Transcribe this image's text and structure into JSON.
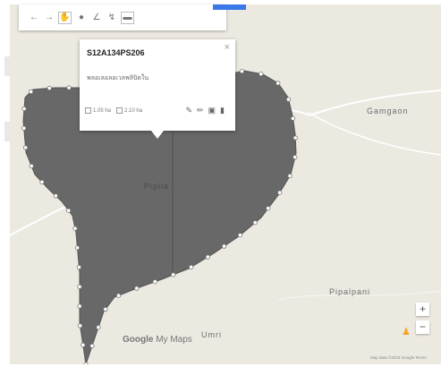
{
  "map": {
    "places": [
      {
        "label": "Gamgaon"
      },
      {
        "label": "Piplia"
      },
      {
        "label": "Pipalpani"
      },
      {
        "label": "Umri"
      }
    ],
    "polygon_fill": "#686868",
    "background": "#ece9e1"
  },
  "popup": {
    "title": "S12A134PS206",
    "text": "พลอเลอลอเวลพลิปิดใน",
    "footer": [
      "1.05 ha",
      "2.10 ha"
    ],
    "close_icon": "close-icon",
    "actions": [
      "paint-icon",
      "edit-icon",
      "camera-icon",
      "delete-icon"
    ]
  },
  "toolbar": {
    "tools": [
      "undo-icon",
      "redo-icon",
      "hand-icon",
      "marker-icon",
      "line-icon",
      "route-icon",
      "ruler-icon"
    ]
  },
  "controls": {
    "zoom_in": "+",
    "zoom_out": "−"
  },
  "branding": {
    "google": "Google",
    "product": " My Maps"
  },
  "attribution": "Map data ©2019 Google   Terms"
}
